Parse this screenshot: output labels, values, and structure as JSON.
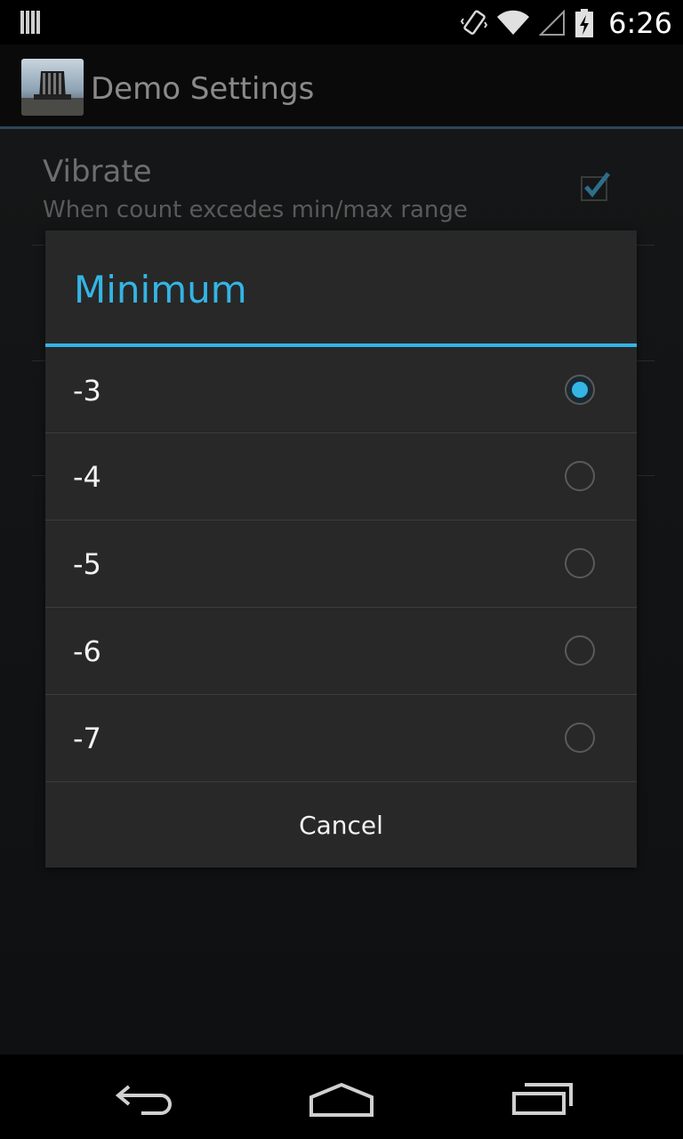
{
  "status_bar": {
    "time": "6:26"
  },
  "action_bar": {
    "title": "Demo Settings"
  },
  "background_preference": {
    "title": "Vibrate",
    "summary": "When count excedes min/max range",
    "checked": true
  },
  "dialog": {
    "title": "Minimum",
    "options": [
      {
        "label": "-3",
        "selected": true
      },
      {
        "label": "-4",
        "selected": false
      },
      {
        "label": "-5",
        "selected": false
      },
      {
        "label": "-6",
        "selected": false
      },
      {
        "label": "-7",
        "selected": false
      }
    ],
    "cancel_label": "Cancel"
  },
  "colors": {
    "accent": "#33b5e5",
    "dialog_bg": "#282828",
    "text_primary": "#f2f2f2"
  },
  "nav_bar": {
    "icons": [
      "back-icon",
      "home-icon",
      "recent-apps-icon"
    ]
  }
}
